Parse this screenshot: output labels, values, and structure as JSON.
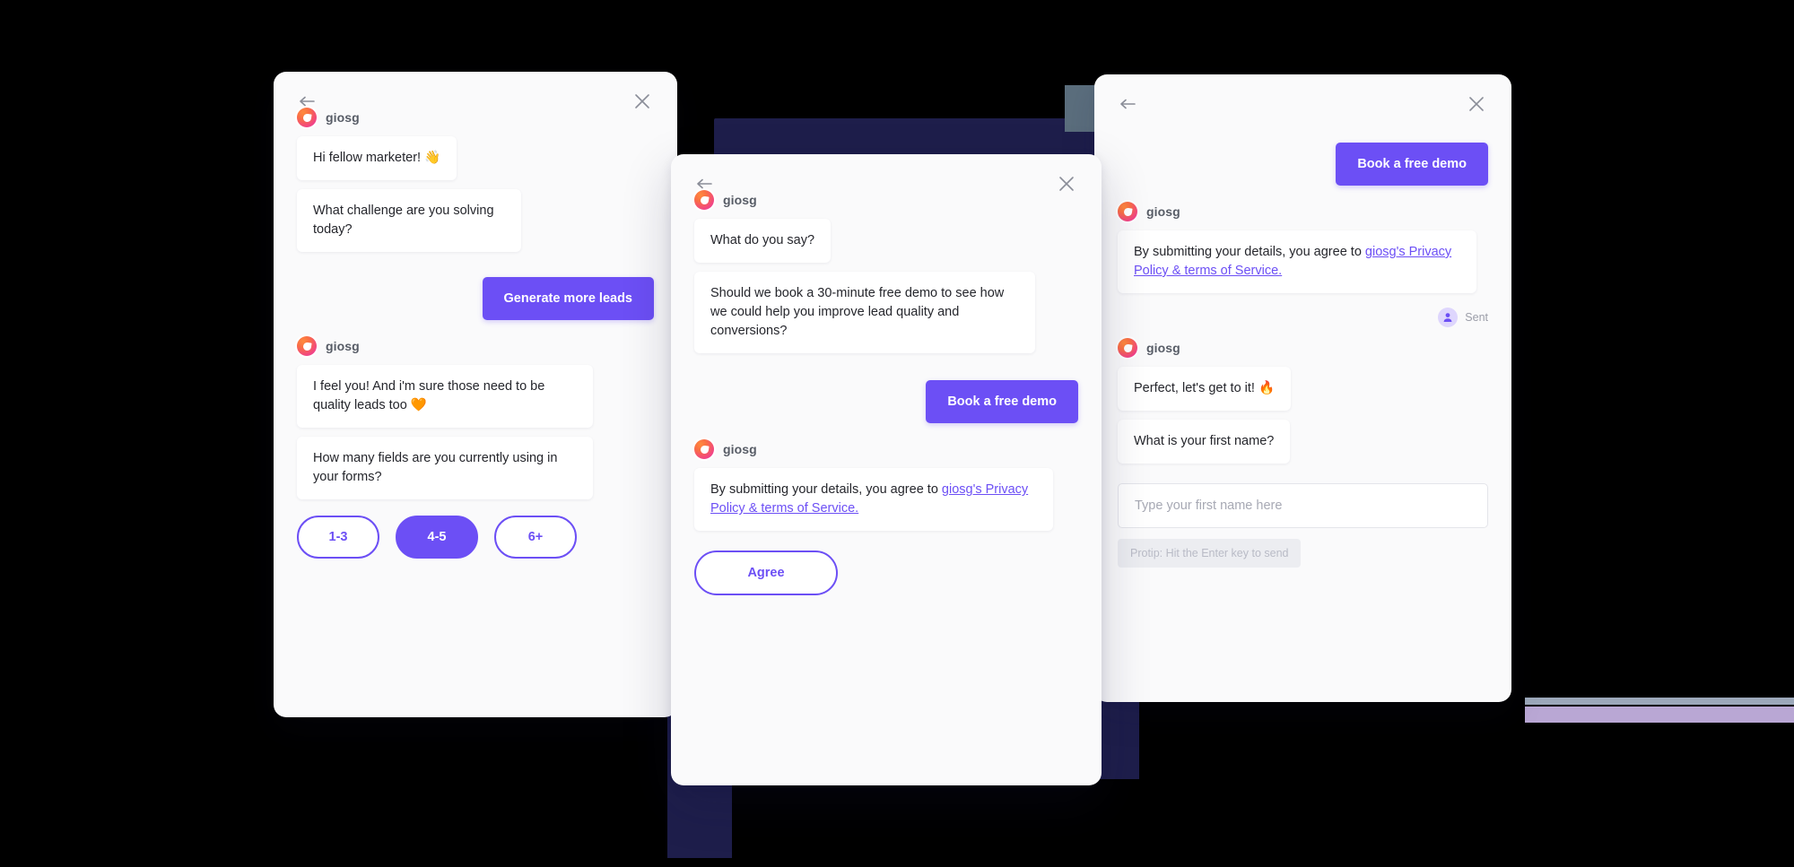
{
  "brand": {
    "name": "giosg",
    "avatar_icon": "giosg-logo-icon"
  },
  "theme": {
    "accent": "#6C4FF5",
    "navy": "#1E1E4B",
    "panel_bg": "#FAFAFB",
    "bubble_bg": "#FFFFFF",
    "text": "#25262C",
    "muted": "#9B9DA8",
    "lavender": "#B9A7D4",
    "slate": "#5B6E7D"
  },
  "icons": {
    "back": "arrow-left-icon",
    "close": "close-icon",
    "person": "person-icon"
  },
  "widget_left": {
    "messages": [
      "Hi fellow marketer! 👋",
      "What challenge are you solving today?"
    ],
    "user_choice": "Generate more leads",
    "messages2": [
      "I feel you! And i'm sure those need to be quality leads too 🧡",
      "How many fields are you currently using in your forms?"
    ],
    "options": [
      {
        "label": "1-3",
        "selected": false
      },
      {
        "label": "4-5",
        "selected": true
      },
      {
        "label": "6+",
        "selected": false
      }
    ]
  },
  "widget_center": {
    "messages": [
      "What do you say?",
      "Should we book a 30-minute free demo to see how we could help you improve lead quality and conversions?"
    ],
    "user_choice": "Book a free demo",
    "consent_prefix": "By submitting your details, you agree to ",
    "consent_link": "giosg's Privacy Policy & terms of Service.",
    "agree_label": "Agree"
  },
  "widget_right": {
    "user_choice": "Book a free demo",
    "consent_prefix": "By submitting your details, you agree to ",
    "consent_link": "giosg's Privacy Policy & terms of Service.",
    "sent_label": "Sent",
    "messages": [
      "Perfect, let's get to it! 🔥",
      "What is your first name?"
    ],
    "input_value": "",
    "input_placeholder": "Type your first name here",
    "protip": "Protip: Hit the Enter key to send"
  }
}
